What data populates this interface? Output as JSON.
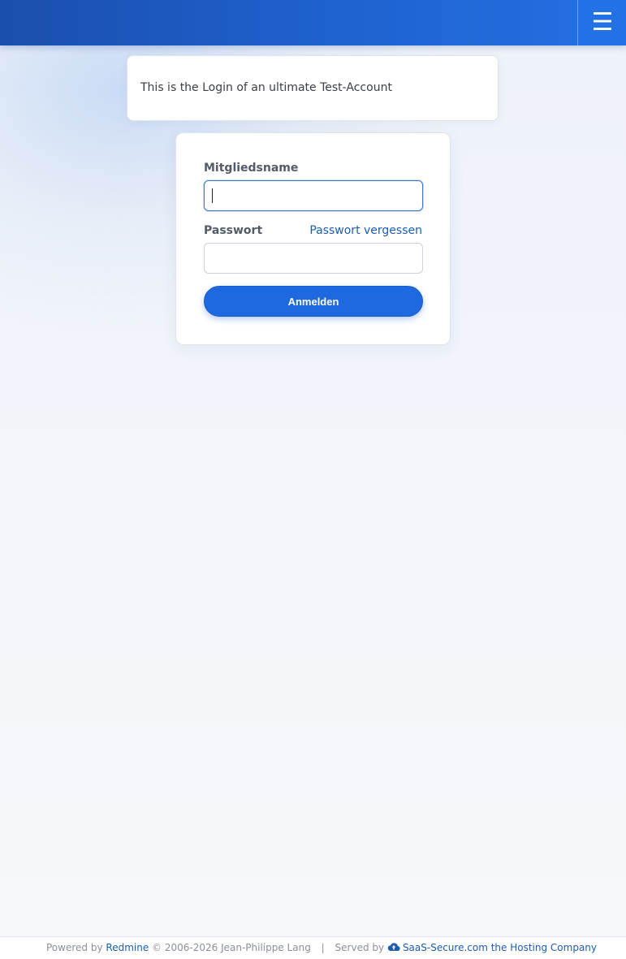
{
  "header": {
    "menu_icon": "☰"
  },
  "notice": {
    "text": "This is the Login of an ultimate Test-Account"
  },
  "login": {
    "username_label": "Mitgliedsname",
    "username_value": "",
    "password_label": "Passwort",
    "password_value": "",
    "lost_password_link": "Passwort vergessen",
    "submit_label": "Anmelden"
  },
  "footer": {
    "powered_by": "Powered by",
    "redmine_link": "Redmine",
    "copyright": "© 2006-2026 Jean-Philippe Lang",
    "separator": "|",
    "served_by": "Served by",
    "host_link": "SaaS-Secure.com the Hosting Company",
    "host_icon": "cloud-upload-icon"
  },
  "colors": {
    "brand_blue": "#1f69e0",
    "link_blue": "#1c5cb0"
  }
}
